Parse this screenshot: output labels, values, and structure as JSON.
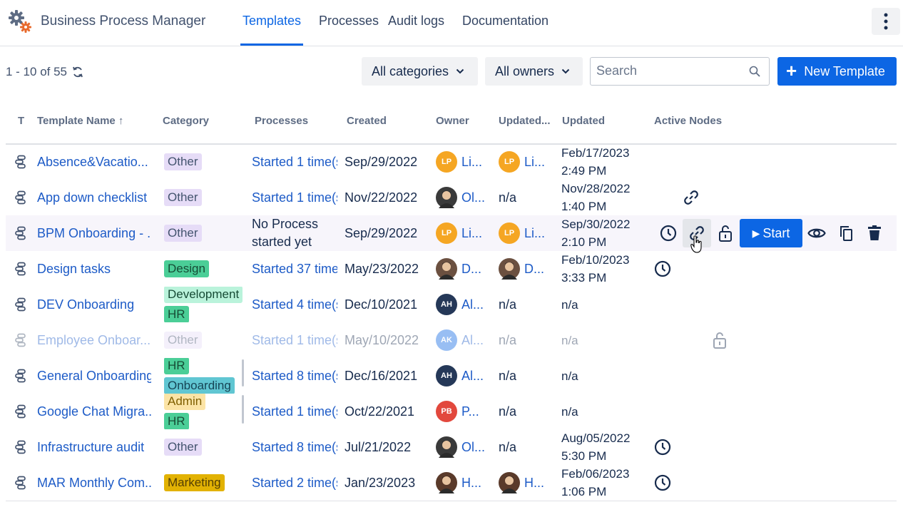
{
  "app": {
    "title": "Business Process Manager",
    "logo_icon": "gears-icon"
  },
  "nav": {
    "tabs": [
      "Templates",
      "Processes",
      "Audit logs",
      "Documentation"
    ],
    "active": "Templates",
    "more_icon": "kebab-menu-icon"
  },
  "toolbar": {
    "count": "1 - 10 of 55",
    "refresh_icon": "refresh-icon",
    "category_filter": "All categories",
    "owner_filter": "All owners",
    "search_placeholder": "Search",
    "new_template": "New Template"
  },
  "table": {
    "columns": [
      "T",
      "Template Name ↑",
      "Category",
      "Processes",
      "Created",
      "Owner",
      "Updated...",
      "Updated",
      "Active Nodes"
    ],
    "rows": [
      {
        "name": "Absence&Vacatio...",
        "tags": [
          {
            "label": "Other",
            "bg": "#e6dcf7",
            "fg": "#44546f"
          }
        ],
        "processes": "Started 1 time(s",
        "created": "Sep/29/2022",
        "owner": {
          "initials": "LP",
          "color": "#f5a623",
          "name": "Li..."
        },
        "updated_by": {
          "initials": "LP",
          "color": "#f5a623",
          "name": "Li..."
        },
        "updated": [
          "Feb/17/2023",
          "2:49 PM"
        ]
      },
      {
        "name": "App down checklist",
        "tags": [
          {
            "label": "Other",
            "bg": "#e6dcf7",
            "fg": "#44546f"
          }
        ],
        "processes": "Started 1 time(s",
        "created": "Nov/22/2022",
        "owner": {
          "initials": "",
          "color": "#3a3a3a",
          "name": "Ol..."
        },
        "updated_by_text": "n/a",
        "updated": [
          "Nov/28/2022",
          "1:40 PM"
        ]
      },
      {
        "name": "BPM Onboarding - ...",
        "tags": [
          {
            "label": "Other",
            "bg": "#e6dcf7",
            "fg": "#44546f"
          }
        ],
        "processes_plain": [
          "No Process",
          "started yet"
        ],
        "created": "Sep/29/2022",
        "owner": {
          "initials": "LP",
          "color": "#f5a623",
          "name": "Li..."
        },
        "updated_by": {
          "initials": "LP",
          "color": "#f5a623",
          "name": "Li..."
        },
        "updated": [
          "Sep/30/2022",
          "2:10 PM"
        ]
      },
      {
        "name": "Design tasks",
        "tags": [
          {
            "label": "Design",
            "bg": "#4bce97",
            "fg": "#164b35"
          }
        ],
        "processes": "Started 37 time",
        "created": "May/23/2022",
        "owner": {
          "initials": "",
          "color": "#6b5040",
          "name": "D..."
        },
        "updated_by": {
          "initials": "",
          "color": "#6b5040",
          "name": "D..."
        },
        "updated": [
          "Feb/10/2023",
          "3:33 PM"
        ]
      },
      {
        "name": "DEV Onboarding",
        "tags": [
          {
            "label": "Development",
            "bg": "#baf3db",
            "fg": "#164b35"
          },
          {
            "label": "HR",
            "bg": "#4bce97",
            "fg": "#164b35"
          }
        ],
        "processes": "Started 4 time(s",
        "created": "Dec/10/2021",
        "owner": {
          "initials": "AH",
          "color": "#253858",
          "name": "Al..."
        },
        "updated_by_text": "n/a",
        "updated_text": "n/a"
      },
      {
        "name": "Employee Onboar...",
        "tags": [
          {
            "label": "Other",
            "bg": "#e6dcf7",
            "fg": "#44546f"
          }
        ],
        "processes": "Started 1 time(s",
        "created": "May/10/2022",
        "owner": {
          "initials": "AK",
          "color": "#0c66e4",
          "name": "Al..."
        },
        "updated_by_text": "n/a",
        "updated_text": "n/a"
      },
      {
        "name": "General Onboarding",
        "tags": [
          {
            "label": "HR",
            "bg": "#4bce97",
            "fg": "#164b35"
          },
          {
            "label": "Onboarding",
            "bg": "#60c6d2",
            "fg": "#164555"
          }
        ],
        "processes": "Started 8 time(s",
        "created": "Dec/16/2021",
        "owner": {
          "initials": "AH",
          "color": "#253858",
          "name": "Al..."
        },
        "updated_by_text": "n/a",
        "updated_text": "n/a"
      },
      {
        "name": "Google Chat Migra...",
        "tags": [
          {
            "label": "Admin",
            "bg": "#fce4a6",
            "fg": "#7f5f01"
          },
          {
            "label": "HR",
            "bg": "#4bce97",
            "fg": "#164b35"
          }
        ],
        "processes": "Started 1 time(s",
        "created": "Oct/22/2021",
        "owner": {
          "initials": "PB",
          "color": "#e2483d",
          "name": "P..."
        },
        "updated_by_text": "n/a",
        "updated_text": "n/a"
      },
      {
        "name": "Infrastructure audit",
        "tags": [
          {
            "label": "Other",
            "bg": "#e6dcf7",
            "fg": "#44546f"
          }
        ],
        "processes": "Started 8 time(s",
        "created": "Jul/21/2022",
        "owner": {
          "initials": "",
          "color": "#3a3a3a",
          "name": "Ol..."
        },
        "updated_by_text": "n/a",
        "updated": [
          "Aug/05/2022",
          "5:30 PM"
        ]
      },
      {
        "name": "MAR Monthly Com...",
        "tags": [
          {
            "label": "Marketing",
            "bg": "#e2b203",
            "fg": "#533f04"
          }
        ],
        "processes": "Started 2 time(s",
        "created": "Jan/23/2023",
        "owner": {
          "initials": "",
          "color": "#5a3a2a",
          "name": "H..."
        },
        "updated_by": {
          "initials": "",
          "color": "#5a3a2a",
          "name": "H..."
        },
        "updated": [
          "Feb/06/2023",
          "1:06 PM"
        ]
      }
    ]
  },
  "row_actions": {
    "start_label": "Start",
    "icons": [
      "clock-icon",
      "link-icon",
      "unlock-icon",
      "eye-icon",
      "copy-icon",
      "trash-icon"
    ]
  },
  "colors": {
    "accent": "#0c66e4",
    "link": "#1d5bc7",
    "hover_row": "#f7f5fb"
  }
}
